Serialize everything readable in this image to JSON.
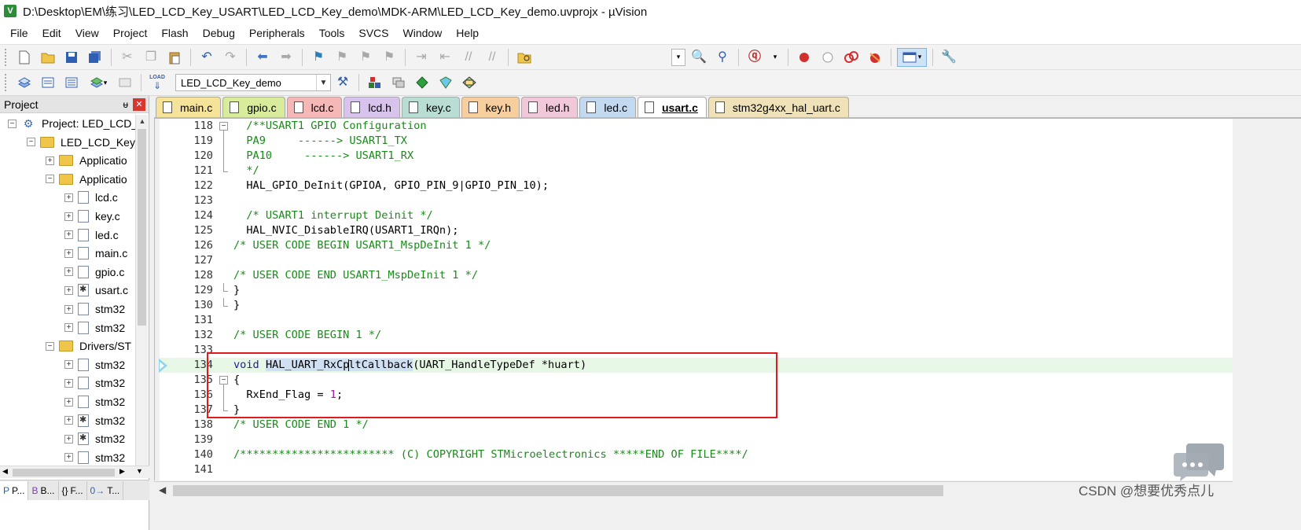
{
  "window": {
    "title": "D:\\Desktop\\EM\\练习\\LED_LCD_Key_USART\\LED_LCD_Key_demo\\MDK-ARM\\LED_LCD_Key_demo.uvprojx - µVision",
    "app_icon_text": "V"
  },
  "menu": [
    "File",
    "Edit",
    "View",
    "Project",
    "Flash",
    "Debug",
    "Peripherals",
    "Tools",
    "SVCS",
    "Window",
    "Help"
  ],
  "toolbar2": {
    "target": "LED_LCD_Key_demo",
    "load_label": "LOAD"
  },
  "project_panel": {
    "title": "Project",
    "pin_glyph": "ᵾ",
    "close_glyph": "✕",
    "tree": [
      {
        "label": "Project: LED_LCD_",
        "icon": "project-icon",
        "expander": "−"
      },
      {
        "label": "LED_LCD_Key_",
        "icon": "target-folder-icon",
        "expander": "−"
      },
      {
        "label": "Applicatio",
        "icon": "folder-icon",
        "expander": "+"
      },
      {
        "label": "Applicatio",
        "icon": "folder-icon",
        "expander": "−"
      },
      {
        "label": "lcd.c",
        "icon": "file-icon",
        "expander": "+"
      },
      {
        "label": "key.c",
        "icon": "file-icon",
        "expander": "+"
      },
      {
        "label": "led.c",
        "icon": "file-icon",
        "expander": "+"
      },
      {
        "label": "main.c",
        "icon": "file-icon",
        "expander": "+"
      },
      {
        "label": "gpio.c",
        "icon": "file-icon",
        "expander": "+"
      },
      {
        "label": "usart.c",
        "icon": "config-file-icon",
        "expander": "+"
      },
      {
        "label": "stm32",
        "icon": "file-icon",
        "expander": "+"
      },
      {
        "label": "stm32",
        "icon": "file-icon",
        "expander": "+"
      },
      {
        "label": "Drivers/ST",
        "icon": "folder-icon",
        "expander": "−"
      },
      {
        "label": "stm32",
        "icon": "file-icon",
        "expander": "+"
      },
      {
        "label": "stm32",
        "icon": "file-icon",
        "expander": "+"
      },
      {
        "label": "stm32",
        "icon": "file-icon",
        "expander": "+"
      },
      {
        "label": "stm32",
        "icon": "config-file-icon",
        "expander": "+"
      },
      {
        "label": "stm32",
        "icon": "config-file-icon",
        "expander": "+"
      },
      {
        "label": "stm32",
        "icon": "file-icon",
        "expander": "+"
      }
    ],
    "bottom_tabs": [
      {
        "label": "P...",
        "icon": "P"
      },
      {
        "label": "B...",
        "icon": "B"
      },
      {
        "label": "F...",
        "icon": "{}"
      },
      {
        "label": "T...",
        "icon": "0→"
      }
    ]
  },
  "tabs": [
    {
      "label": "main.c",
      "color": "#f5e39a",
      "active": false
    },
    {
      "label": "gpio.c",
      "color": "#d9ec9c",
      "active": false
    },
    {
      "label": "lcd.c",
      "color": "#f6b7b7",
      "active": false
    },
    {
      "label": "lcd.h",
      "color": "#d7c3ec",
      "active": false
    },
    {
      "label": "key.c",
      "color": "#b9dcd3",
      "active": false
    },
    {
      "label": "key.h",
      "color": "#f7cf9f",
      "active": false
    },
    {
      "label": "led.h",
      "color": "#f0c8d9",
      "active": false
    },
    {
      "label": "led.c",
      "color": "#c3d9ef",
      "active": false
    },
    {
      "label": "usart.c",
      "color": "#ffffff",
      "active": true
    },
    {
      "label": "stm32g4xx_hal_uart.c",
      "color": "#efe2b9",
      "active": false
    }
  ],
  "code_lines": [
    {
      "num": "118",
      "fold": "box",
      "text": "  /**USART1 GPIO Configuration",
      "kind": "comment"
    },
    {
      "num": "119",
      "fold": "line",
      "text": "  PA9     ------> USART1_TX",
      "kind": "comment"
    },
    {
      "num": "120",
      "fold": "line",
      "text": "  PA10     ------> USART1_RX",
      "kind": "comment"
    },
    {
      "num": "121",
      "fold": "end",
      "text": "  */",
      "kind": "comment"
    },
    {
      "num": "122",
      "fold": "",
      "text": "  HAL_GPIO_DeInit(GPIOA, GPIO_PIN_9|GPIO_PIN_10);",
      "kind": "plain"
    },
    {
      "num": "123",
      "fold": "",
      "text": "",
      "kind": "plain"
    },
    {
      "num": "124",
      "fold": "",
      "text": "  /* USART1 interrupt Deinit */",
      "kind": "comment"
    },
    {
      "num": "125",
      "fold": "",
      "text": "  HAL_NVIC_DisableIRQ(USART1_IRQn);",
      "kind": "plain"
    },
    {
      "num": "126",
      "fold": "",
      "text": "/* USER CODE BEGIN USART1_MspDeInit 1 */",
      "kind": "comment"
    },
    {
      "num": "127",
      "fold": "",
      "text": "",
      "kind": "plain"
    },
    {
      "num": "128",
      "fold": "",
      "text": "/* USER CODE END USART1_MspDeInit 1 */",
      "kind": "comment"
    },
    {
      "num": "129",
      "fold": "end",
      "text": "}",
      "kind": "plain"
    },
    {
      "num": "130",
      "fold": "end",
      "text": "}",
      "kind": "plain"
    },
    {
      "num": "131",
      "fold": "",
      "text": "",
      "kind": "plain"
    },
    {
      "num": "132",
      "fold": "",
      "text": "/* USER CODE BEGIN 1 */",
      "kind": "comment"
    },
    {
      "num": "133",
      "fold": "",
      "text": "",
      "kind": "plain"
    },
    {
      "num": "134",
      "fold": "",
      "text": "void HAL_UART_RxCpltCallback(UART_HandleTypeDef *huart)",
      "kind": "func"
    },
    {
      "num": "135",
      "fold": "box",
      "text": "{",
      "kind": "plain"
    },
    {
      "num": "136",
      "fold": "line",
      "text": "  RxEnd_Flag = 1;",
      "kind": "assign"
    },
    {
      "num": "137",
      "fold": "end",
      "text": "}",
      "kind": "plain"
    },
    {
      "num": "138",
      "fold": "",
      "text": "/* USER CODE END 1 */",
      "kind": "comment"
    },
    {
      "num": "139",
      "fold": "",
      "text": "",
      "kind": "plain"
    },
    {
      "num": "140",
      "fold": "",
      "text": "/************************ (C) COPYRIGHT STMicroelectronics *****END OF FILE****/",
      "kind": "comment"
    },
    {
      "num": "141",
      "fold": "",
      "text": "",
      "kind": "plain"
    }
  ],
  "code_tokens": {
    "kw_void": "void",
    "fn_pre": "HAL_UART_RxCp",
    "fn_post": "ltCallback",
    "fn_args": "(UART_HandleTypeDef *huart)",
    "assign_lhs": "  RxEnd_Flag = ",
    "assign_num": "1",
    "assign_end": ";"
  },
  "watermark": "CSDN @想要优秀点儿",
  "colors": {
    "comment": "#1a8a1a",
    "keyword": "#1a1aa6",
    "number": "#9b1f9b",
    "highlight_box": "#e01b1b",
    "current_line": "#e6f7e6"
  }
}
